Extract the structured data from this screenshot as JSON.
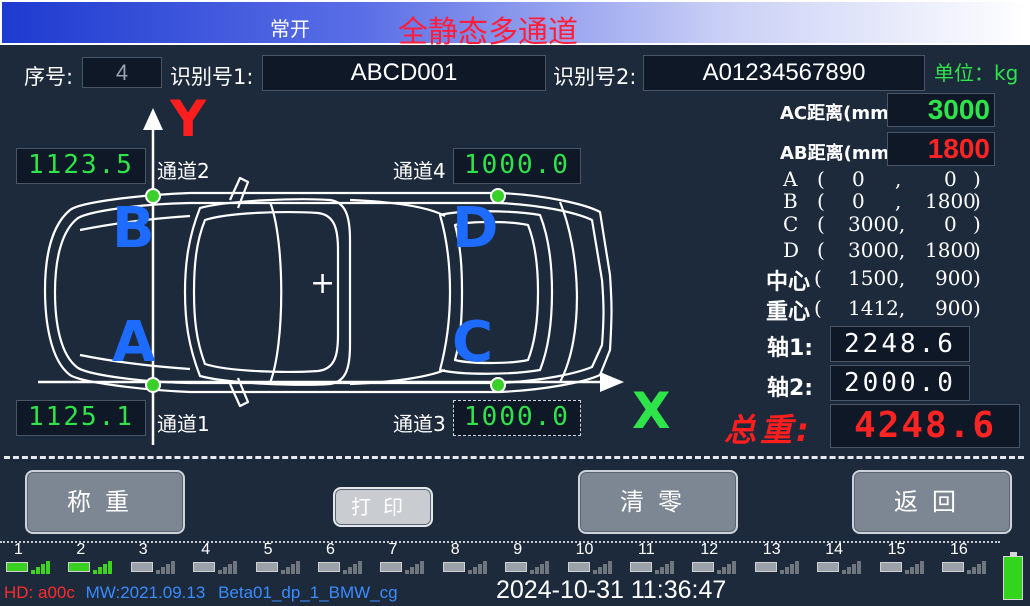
{
  "header": {
    "mode": "常开",
    "title": "全静态多通道"
  },
  "info": {
    "seq_label": "序号:",
    "seq_value": "4",
    "id1_label": "识别号1:",
    "id1_value": "ABCD001",
    "id2_label": "识别号2:",
    "id2_value": "A01234567890",
    "unit_label": "单位：kg"
  },
  "diagram": {
    "axis_y": "Y",
    "axis_x": "X",
    "point_a": "A",
    "point_b": "B",
    "point_c": "C",
    "point_d": "D",
    "center_mark": "+",
    "channels": {
      "ch1": {
        "label": "通道1",
        "value": "1125.1"
      },
      "ch2": {
        "label": "通道2",
        "value": "1123.5"
      },
      "ch3": {
        "label": "通道3",
        "value": "1000.0"
      },
      "ch4": {
        "label": "通道4",
        "value": "1000.0"
      }
    }
  },
  "distances": {
    "ac_label": "AC距离(mm)",
    "ac_value": "3000",
    "ab_label": "AB距离(mm)",
    "ab_value": "1800"
  },
  "coords": {
    "a": {
      "name": "A",
      "x": "0",
      "y": "0"
    },
    "b": {
      "name": "B",
      "x": "0",
      "y": "1800"
    },
    "c": {
      "name": "C",
      "x": "3000,",
      "y": "0"
    },
    "d": {
      "name": "D",
      "x": "3000,",
      "y": "1800"
    },
    "center": {
      "name": "中心",
      "x": "1500,",
      "y": "900"
    },
    "cog": {
      "name": "重心",
      "x": "1412,",
      "y": "900"
    }
  },
  "axles": {
    "axle1_label": "轴1:",
    "axle1_value": "2248.6",
    "axle2_label": "轴2:",
    "axle2_value": "2000.0",
    "total_label": "总重:",
    "total_value": "4248.6"
  },
  "buttons": {
    "weigh": "称重",
    "print": "打印",
    "zero": "清零",
    "back": "返回"
  },
  "channels_bar": [
    "1",
    "2",
    "3",
    "4",
    "5",
    "6",
    "7",
    "8",
    "9",
    "10",
    "11",
    "12",
    "13",
    "14",
    "15",
    "16"
  ],
  "status": {
    "hd": "HD: a00c",
    "mw": "MW:2021.09.13",
    "build": "Beta01_dp_1_BMW_cg",
    "datetime": "2024-10-31 11:36:47"
  },
  "colors": {
    "accent_green": "#2fe34a",
    "accent_red": "#ff2424",
    "title_red": "#ff1e3c",
    "marker_blue": "#1e6bff"
  }
}
